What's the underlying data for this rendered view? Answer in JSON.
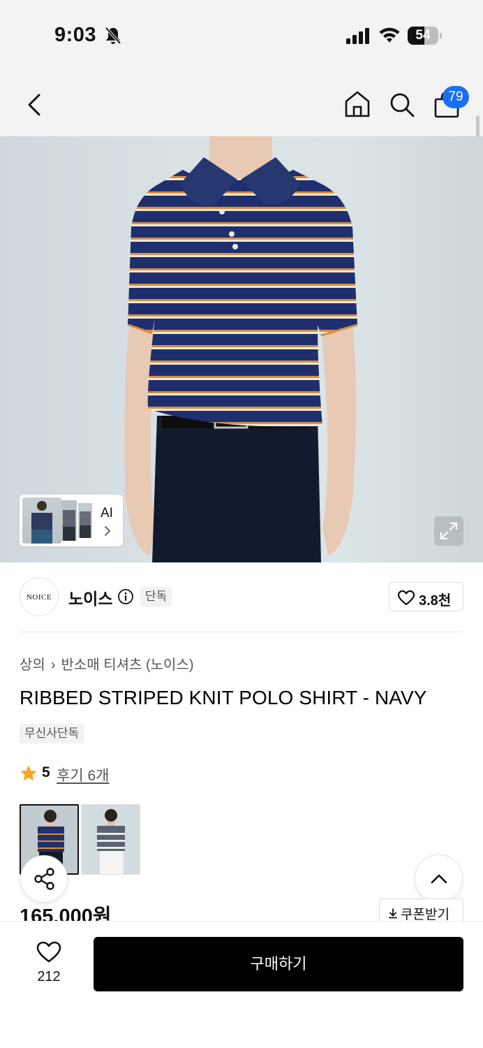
{
  "status_bar": {
    "time": "9:03",
    "battery_level": "54",
    "icons": [
      "bell-slash-icon",
      "signal-icon",
      "wifi-icon",
      "battery-icon"
    ]
  },
  "nav": {
    "icons": [
      "back-chevron-icon",
      "home-icon",
      "search-icon",
      "shopping-bag-icon"
    ],
    "cart_count": "79"
  },
  "gallery": {
    "ai_label": "AI",
    "icons": [
      "chevron-right-icon",
      "expand-icon"
    ]
  },
  "brand": {
    "logo_text": "NOICE",
    "name": "노이스",
    "exclusive_badge": "단독",
    "likes": "3.8천",
    "icons": [
      "info-icon",
      "heart-outline-icon"
    ]
  },
  "product": {
    "breadcrumb": [
      "상의",
      "반소매 티셔츠 (노이스)"
    ],
    "title": "RIBBED STRIPED KNIT POLO SHIRT - NAVY",
    "tag": "무신사단독",
    "rating": "5",
    "review_link": "후기 6개",
    "price": "165,000원",
    "coupon_label": "쿠폰받기",
    "variants": [
      "navy",
      "grey"
    ]
  },
  "bottom_bar": {
    "wishlist_count": "212",
    "buy_label": "구매하기"
  },
  "colors": {
    "accent": "#1a6ef5",
    "star": "#f5a623",
    "buy_button": "#000000",
    "stripe_navy": "#1f2f6e",
    "stripe_orange": "#d98f3c"
  }
}
